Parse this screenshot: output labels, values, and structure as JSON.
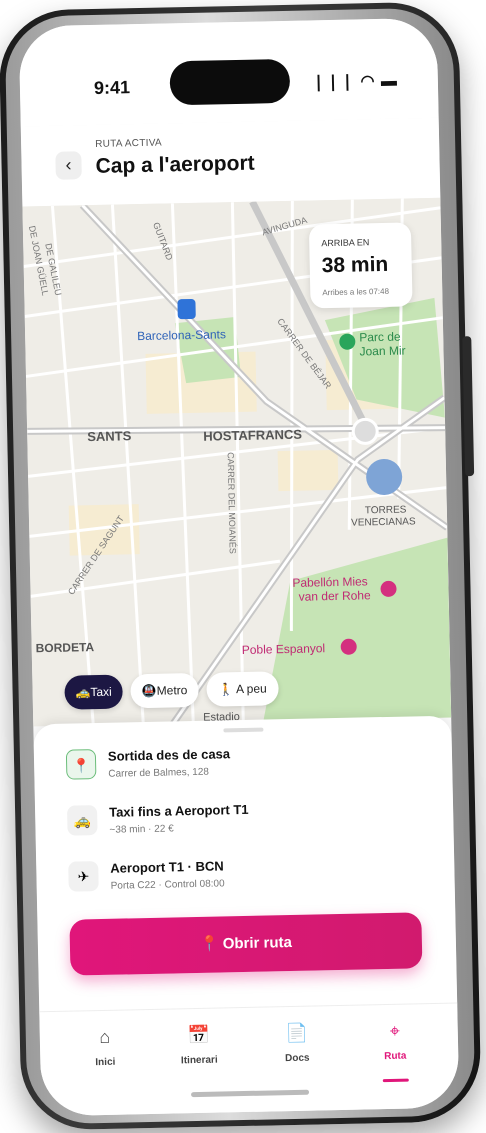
{
  "status_bar": {
    "time": "9:41",
    "icons": "❘❘❘ ◠ ▬"
  },
  "header": {
    "back_glyph": "‹",
    "eyebrow": "RUTA ACTIVA",
    "title": "Cap a l'aeroport"
  },
  "map": {
    "eta": {
      "label": "ARRIBA EN",
      "value": "38 min",
      "sub": "Arribes a les 07:48"
    },
    "labels": {
      "station": "Barcelona-Sants",
      "park": "Parc de",
      "park2": "Joan Mir",
      "sants": "SANTS",
      "hostafrancs": "HOSTAFRANCS",
      "torres1": "TORRES",
      "torres2": "VENECIANAS",
      "pabellon1": "Pabellón Mies",
      "pabellon2": "van der Rohe",
      "poble": "Poble Espanyol",
      "bordeta": "BORDETA",
      "estadio": "Estadio",
      "street_vinguda": "AVINGUDA",
      "street_guitard": "GUITARD",
      "street_bejar": "CARRER DE BÉJAR",
      "street_molanes": "CARRER DEL MOIANÉS",
      "street_sagunt": "CARRER DE SAGUNT",
      "street_joan": "DE JOAN GÜELL",
      "street_galileu": "DE GALILEU"
    }
  },
  "chips": [
    {
      "label": "🚕Taxi",
      "active": true
    },
    {
      "label": "🚇Metro",
      "active": false
    },
    {
      "label": "🚶 A peu",
      "active": false
    }
  ],
  "steps": [
    {
      "icon": "📍",
      "title": "Sortida des de casa",
      "sub": "Carrer de Balmes, 128"
    },
    {
      "icon": "🚕",
      "title": "Taxi fins a Aeroport T1",
      "sub": "~38 min · 22 €"
    },
    {
      "icon": "✈",
      "title": "Aeroport T1 · BCN",
      "sub": "Porta C22 · Control 08:00"
    }
  ],
  "cta": {
    "label": "📍  Obrir ruta"
  },
  "tabs": [
    {
      "icon": "⌂",
      "label": "Inici",
      "active": false
    },
    {
      "icon": "📅",
      "label": "Itinerari",
      "active": false
    },
    {
      "icon": "📄",
      "label": "Docs",
      "active": false
    },
    {
      "icon": "⌖",
      "label": "Ruta",
      "active": true
    }
  ],
  "colors": {
    "accent": "#e0167a",
    "chip_active": "#1c1743"
  }
}
